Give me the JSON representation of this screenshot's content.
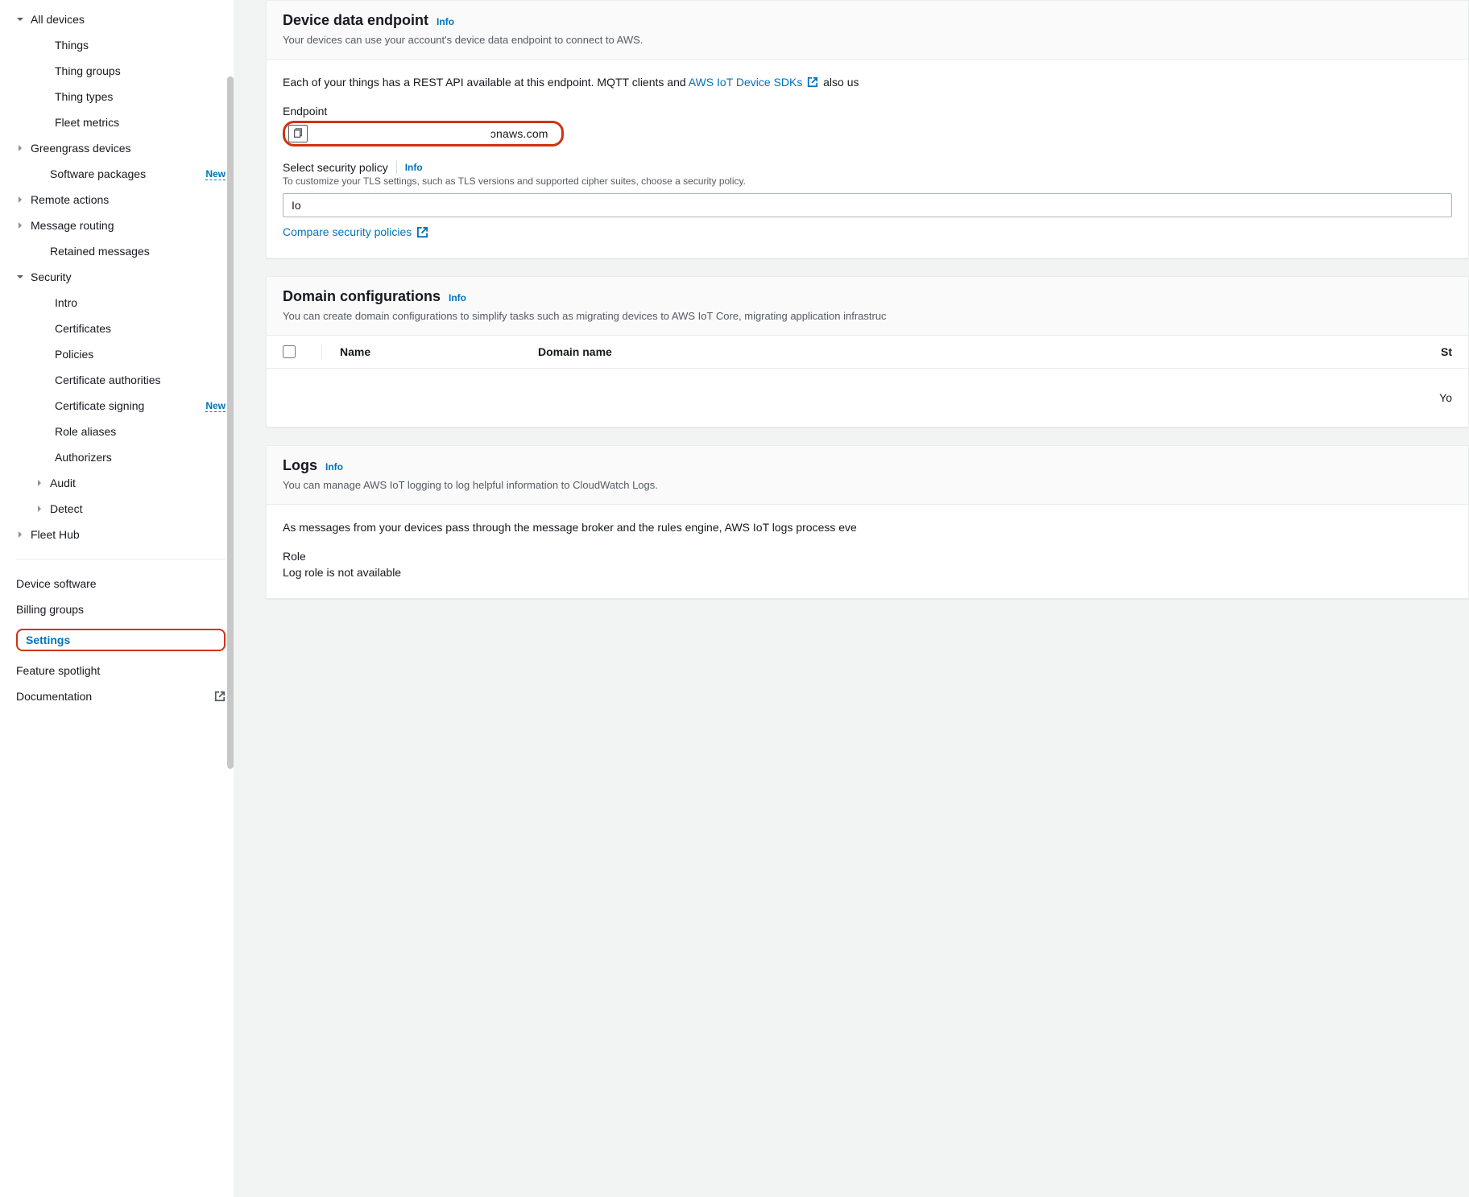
{
  "sidebar": {
    "items": [
      {
        "label": "All devices",
        "level": 0,
        "expand": "open"
      },
      {
        "label": "Things",
        "level": 2
      },
      {
        "label": "Thing groups",
        "level": 2
      },
      {
        "label": "Thing types",
        "level": 2
      },
      {
        "label": "Fleet metrics",
        "level": 2
      },
      {
        "label": "Greengrass devices",
        "level": 0,
        "expand": "closed"
      },
      {
        "label": "Software packages",
        "level": 1,
        "badge": "New"
      },
      {
        "label": "Remote actions",
        "level": 0,
        "expand": "closed"
      },
      {
        "label": "Message routing",
        "level": 0,
        "expand": "closed"
      },
      {
        "label": "Retained messages",
        "level": 1
      },
      {
        "label": "Security",
        "level": 0,
        "expand": "open"
      },
      {
        "label": "Intro",
        "level": 2
      },
      {
        "label": "Certificates",
        "level": 2
      },
      {
        "label": "Policies",
        "level": 2
      },
      {
        "label": "Certificate authorities",
        "level": 2
      },
      {
        "label": "Certificate signing",
        "level": 2,
        "badge": "New"
      },
      {
        "label": "Role aliases",
        "level": 2
      },
      {
        "label": "Authorizers",
        "level": 2
      },
      {
        "label": "Audit",
        "level": 1,
        "expand": "closed"
      },
      {
        "label": "Detect",
        "level": 1,
        "expand": "closed"
      },
      {
        "label": "Fleet Hub",
        "level": 0,
        "expand": "closed"
      }
    ],
    "footer_items": [
      {
        "label": "Device software"
      },
      {
        "label": "Billing groups"
      },
      {
        "label": "Settings",
        "highlighted": true
      },
      {
        "label": "Feature spotlight"
      },
      {
        "label": "Documentation",
        "external": true
      }
    ]
  },
  "main": {
    "info_label": "Info",
    "device_data": {
      "title": "Device data endpoint",
      "subtitle": "Your devices can use your account's device data endpoint to connect to AWS.",
      "body_prefix": "Each of your things has a REST API available at this endpoint. MQTT clients and ",
      "sdk_link": "AWS IoT Device SDKs",
      "body_suffix": " also us",
      "endpoint_label": "Endpoint",
      "endpoint_value": "                                                      ɔnaws.com",
      "security_policy_label": "Select security policy",
      "security_policy_help": "To customize your TLS settings, such as TLS versions and supported cipher suites, choose a security policy.",
      "security_policy_value": "Io          ",
      "compare_link": "Compare security policies"
    },
    "domain_config": {
      "title": "Domain configurations",
      "subtitle": "You can create domain configurations to simplify tasks such as migrating devices to AWS IoT Core, migrating application infrastruc",
      "columns": {
        "name": "Name",
        "domain": "Domain name",
        "status": "St"
      },
      "empty_text": "Yo"
    },
    "logs": {
      "title": "Logs",
      "subtitle": "You can manage AWS IoT logging to log helpful information to CloudWatch Logs.",
      "body": "As messages from your devices pass through the message broker and the rules engine, AWS IoT logs process eve",
      "role_label": "Role",
      "role_value": "Log role is not available"
    }
  }
}
